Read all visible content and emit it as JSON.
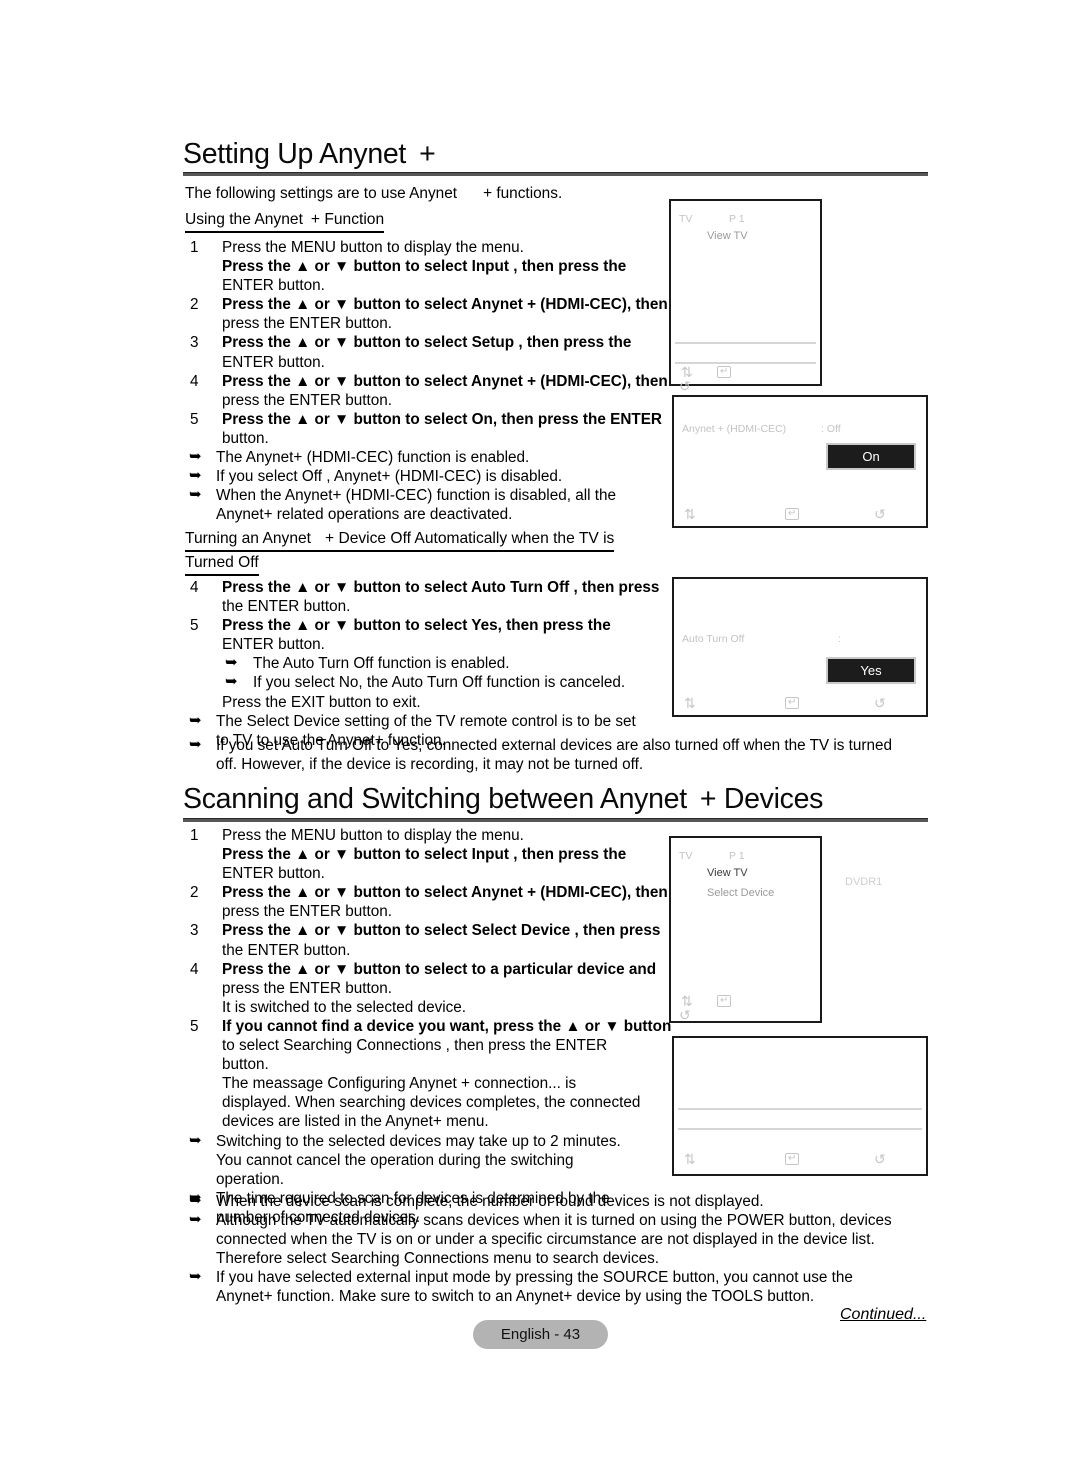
{
  "document": {
    "page_badge": "English - 43",
    "continued": "Continued..."
  },
  "section1": {
    "title": "Setting Up Anynet",
    "title_suffix": "+",
    "intro_a": "The following settings are to use Anynet",
    "intro_b": "+ functions.",
    "subheading_a": "Using the Anynet",
    "subheading_b": "+ Function",
    "steps": [
      {
        "num": "1",
        "lines": [
          {
            "text": "Press the MENU button to display the menu.",
            "bold": false
          },
          {
            "text": "Press the ▲ or ▼ button to select Input , then press the",
            "bold": true
          },
          {
            "text": "ENTER button.",
            "bold": false
          }
        ]
      },
      {
        "num": "2",
        "lines": [
          {
            "text": "Press the ▲ or ▼ button to select Anynet + (HDMI-CEC), then",
            "bold": true
          },
          {
            "text": "press the ENTER button.",
            "bold": false
          }
        ]
      },
      {
        "num": "3",
        "lines": [
          {
            "text": "Press the ▲ or ▼ button to select Setup , then press the",
            "bold": true
          },
          {
            "text": "ENTER button.",
            "bold": false
          }
        ]
      },
      {
        "num": "4",
        "lines": [
          {
            "text": "Press the ▲ or ▼ button to select Anynet + (HDMI-CEC), then",
            "bold": true
          },
          {
            "text": "press the ENTER button.",
            "bold": false
          }
        ]
      },
      {
        "num": "5",
        "lines": [
          {
            "text": "Press the ▲ or ▼ button to select On, then press the ENTER",
            "bold": true
          },
          {
            "text": "button.",
            "bold": false
          }
        ]
      }
    ],
    "notes": [
      [
        "The Anynet+ (HDMI-CEC) function is enabled."
      ],
      [
        "If you select Off , Anynet+ (HDMI-CEC) is disabled."
      ],
      [
        "When the Anynet+ (HDMI-CEC) function is disabled, all the",
        "Anynet+ related operations are deactivated."
      ]
    ]
  },
  "section1b": {
    "subheading_a": "Turning an Anynet",
    "subheading_b": "+ Device Off Automatically when the TV is",
    "subheading_line2": "Turned Off",
    "steps": [
      {
        "num": "4",
        "lines": [
          {
            "text": "Press the ▲ or ▼ button to select Auto Turn Off , then press",
            "bold": true
          },
          {
            "text": "the ENTER button.",
            "bold": false
          }
        ]
      },
      {
        "num": "5",
        "lines": [
          {
            "text": "Press the ▲ or ▼ button to select Yes, then press the",
            "bold": true
          },
          {
            "text": "ENTER button.",
            "bold": false
          }
        ]
      }
    ],
    "inner_notes": [
      [
        "The Auto Turn Off function is enabled."
      ],
      [
        "If you select No, the Auto Turn Off function is canceled."
      ]
    ],
    "exit_line": "Press the EXIT button to exit.",
    "notes": [
      [
        "The Select Device setting of the TV remote control is to be set",
        "to TV to use the Anynet+ function."
      ],
      [
        "If you set Auto Turn Off  to Yes, connected external devices are also turned off when the TV is turned",
        "off. However, if the device is recording, it may not be turned off."
      ]
    ]
  },
  "section2": {
    "title_a": "Scanning and Switching between Anynet",
    "title_b": "+ Devices",
    "steps": [
      {
        "num": "1",
        "lines": [
          {
            "text": "Press the MENU button to display the menu.",
            "bold": false
          },
          {
            "text": "Press the ▲ or ▼ button to select Input , then press the",
            "bold": true
          },
          {
            "text": "ENTER button.",
            "bold": false
          }
        ]
      },
      {
        "num": "2",
        "lines": [
          {
            "text": "Press the ▲ or ▼ button to select Anynet + (HDMI-CEC), then",
            "bold": true
          },
          {
            "text": "press the ENTER button.",
            "bold": false
          }
        ]
      },
      {
        "num": "3",
        "lines": [
          {
            "text": "Press the ▲ or ▼ button to select Select Device , then press",
            "bold": true
          },
          {
            "text": "the ENTER button.",
            "bold": false
          }
        ]
      },
      {
        "num": "4",
        "lines": [
          {
            "text": "Press the ▲ or ▼ button to select to a particular device and",
            "bold": true
          },
          {
            "text": "press the ENTER button.",
            "bold": false
          },
          {
            "text": "It is switched to the selected device.",
            "bold": false
          }
        ]
      },
      {
        "num": "5",
        "lines": [
          {
            "text": "If you cannot find a device you want, press the ▲ or ▼ button",
            "bold": true
          },
          {
            "text": "to select Searching Connections  , then press the ENTER",
            "bold": false
          },
          {
            "text": "button.",
            "bold": false
          },
          {
            "text": "The meassage Configuring Anynet  + connection...  is",
            "bold": false
          },
          {
            "text": "displayed. When searching devices completes, the connected",
            "bold": false
          },
          {
            "text": "devices are listed in the Anynet+ menu.",
            "bold": false
          }
        ]
      }
    ],
    "notes": [
      [
        "Switching to the selected devices may take up to 2 minutes.",
        "You cannot cancel the operation during the switching",
        "operation."
      ],
      [
        "The time required to scan for devices is determined by the",
        "number of connected devices."
      ],
      [
        "When the device scan is complete, the number of found devices is not displayed."
      ],
      [
        "Although the TV automatically scans devices when it is turned on using the POWER button, devices",
        "connected when the TV is on or under a specific circumstance are not displayed in the device list.",
        "Therefore select Searching Connections   menu to search devices."
      ],
      [
        "If you have selected external input mode by pressing the SOURCE button, you cannot use the",
        "Anynet+ function. Make sure to switch to an Anynet+ device by using the TOOLS button."
      ]
    ]
  },
  "tv_screens": {
    "screen1": {
      "label_tv": "TV",
      "label_p1": "P 1",
      "item_view_tv": "View TV",
      "icon_updown": "⇅",
      "icon_enter": "↵",
      "icon_return": "↺"
    },
    "screen2": {
      "setting_label": "Anynet + (HDMI-CEC)",
      "setting_value": ": Off",
      "highlight_value": "On",
      "icon_updown": "⇅",
      "icon_enter": "↵",
      "icon_return": "↺"
    },
    "screen3": {
      "setting_label": "Auto Turn Off",
      "setting_value": ":",
      "highlight_value": "Yes",
      "icon_updown": "⇅",
      "icon_enter": "↵",
      "icon_return": "↺"
    },
    "screen4": {
      "label_tv": "TV",
      "label_p1": "P 1",
      "item_view_tv": "View TV",
      "item_select_device": "Select Device",
      "outside_label": "DVDR1",
      "icon_updown": "⇅",
      "icon_enter": "↵",
      "icon_return": "↺"
    },
    "screen5": {
      "icon_updown": "⇅",
      "icon_enter": "↵",
      "icon_return": "↺"
    }
  }
}
